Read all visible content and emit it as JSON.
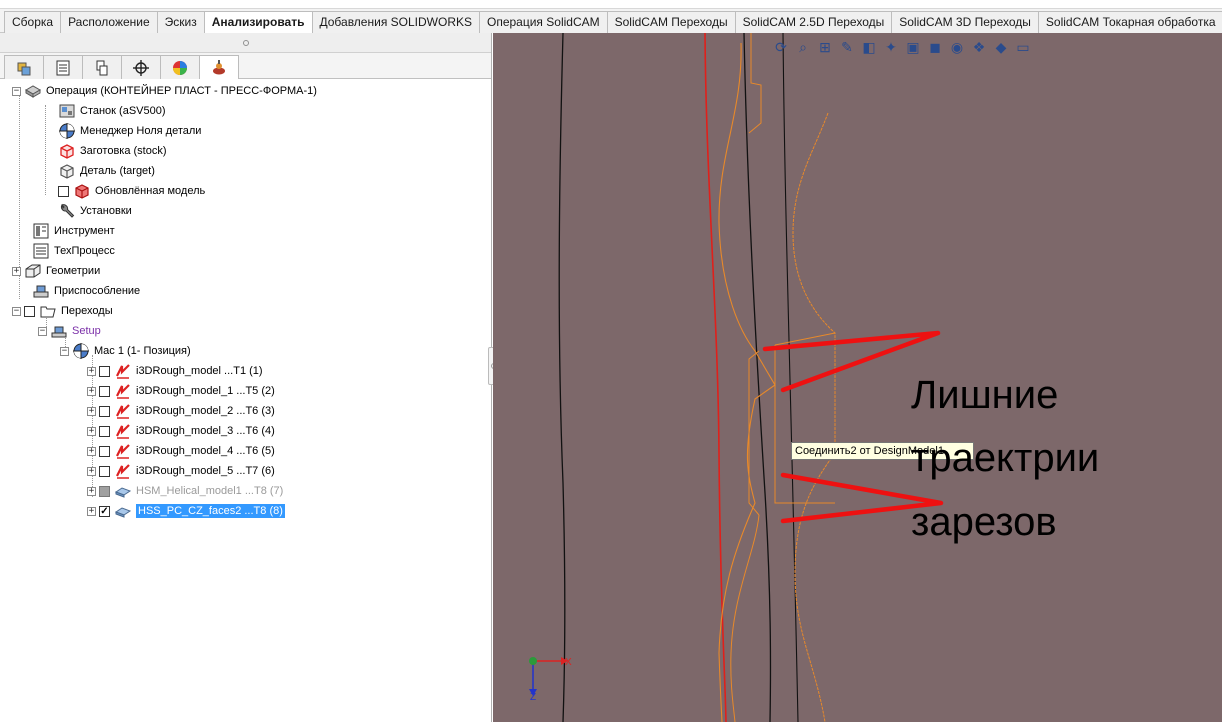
{
  "ribbon": {
    "tabs": [
      "Сборка",
      "Расположение",
      "Эскиз",
      "Анализировать",
      "Добавления SOLIDWORKS",
      "Операция  SolidCAM",
      "SolidCAM Переходы",
      "SolidCAM 2.5D Переходы",
      "SolidCAM 3D Переходы",
      "SolidCAM Токарная обработка"
    ],
    "active_index": 3
  },
  "panel": {
    "tab_icons": [
      "assembly-icon",
      "feature-tree-icon",
      "property-icon",
      "origin-icon",
      "appearance-icon",
      "solidcam-icon"
    ]
  },
  "tree": {
    "root": "Операция (КОНТЕЙНЕР ПЛАСТ - ПРЕСС-ФОРМА-1)",
    "machine": "Станок (aSV500)",
    "zero_manager": "Менеджер Ноля детали",
    "stock": "Заготовка (stock)",
    "target": "Деталь (target)",
    "updated_model": "Обновлённая модель",
    "settings": "Установки",
    "tool": "Инструмент",
    "techprocess": "ТехПроцесс",
    "geometries": "Геометрии",
    "fixture": "Приспособление",
    "operations": "Переходы",
    "setup": "Setup",
    "mac": "Mac 1 (1- Позиция)",
    "ops": [
      {
        "label": "i3DRough_model ...T1 (1)",
        "checked": false
      },
      {
        "label": "i3DRough_model_1 ...T5 (2)",
        "checked": false
      },
      {
        "label": "i3DRough_model_2 ...T6 (3)",
        "checked": false
      },
      {
        "label": "i3DRough_model_3 ...T6 (4)",
        "checked": false
      },
      {
        "label": "i3DRough_model_4 ...T6 (5)",
        "checked": false
      },
      {
        "label": "i3DRough_model_5 ...T7 (6)",
        "checked": false
      },
      {
        "label": "HSM_Helical_model1 ...T8 (7)",
        "checked": false
      },
      {
        "label": "HSS_PC_CZ_faces2 ...T8 (8)",
        "checked": true
      }
    ]
  },
  "viewport": {
    "tooltip": "Соединить2 от DesignModel1",
    "annotation_lines": [
      "Лишние",
      "траектрии",
      "зарезов"
    ],
    "axis_x": "X",
    "axis_z": "Z",
    "colors": {
      "background": "#7d686a",
      "toolpath": "#e8892a",
      "red_line": "#e0201b",
      "black_line": "#111111"
    }
  }
}
